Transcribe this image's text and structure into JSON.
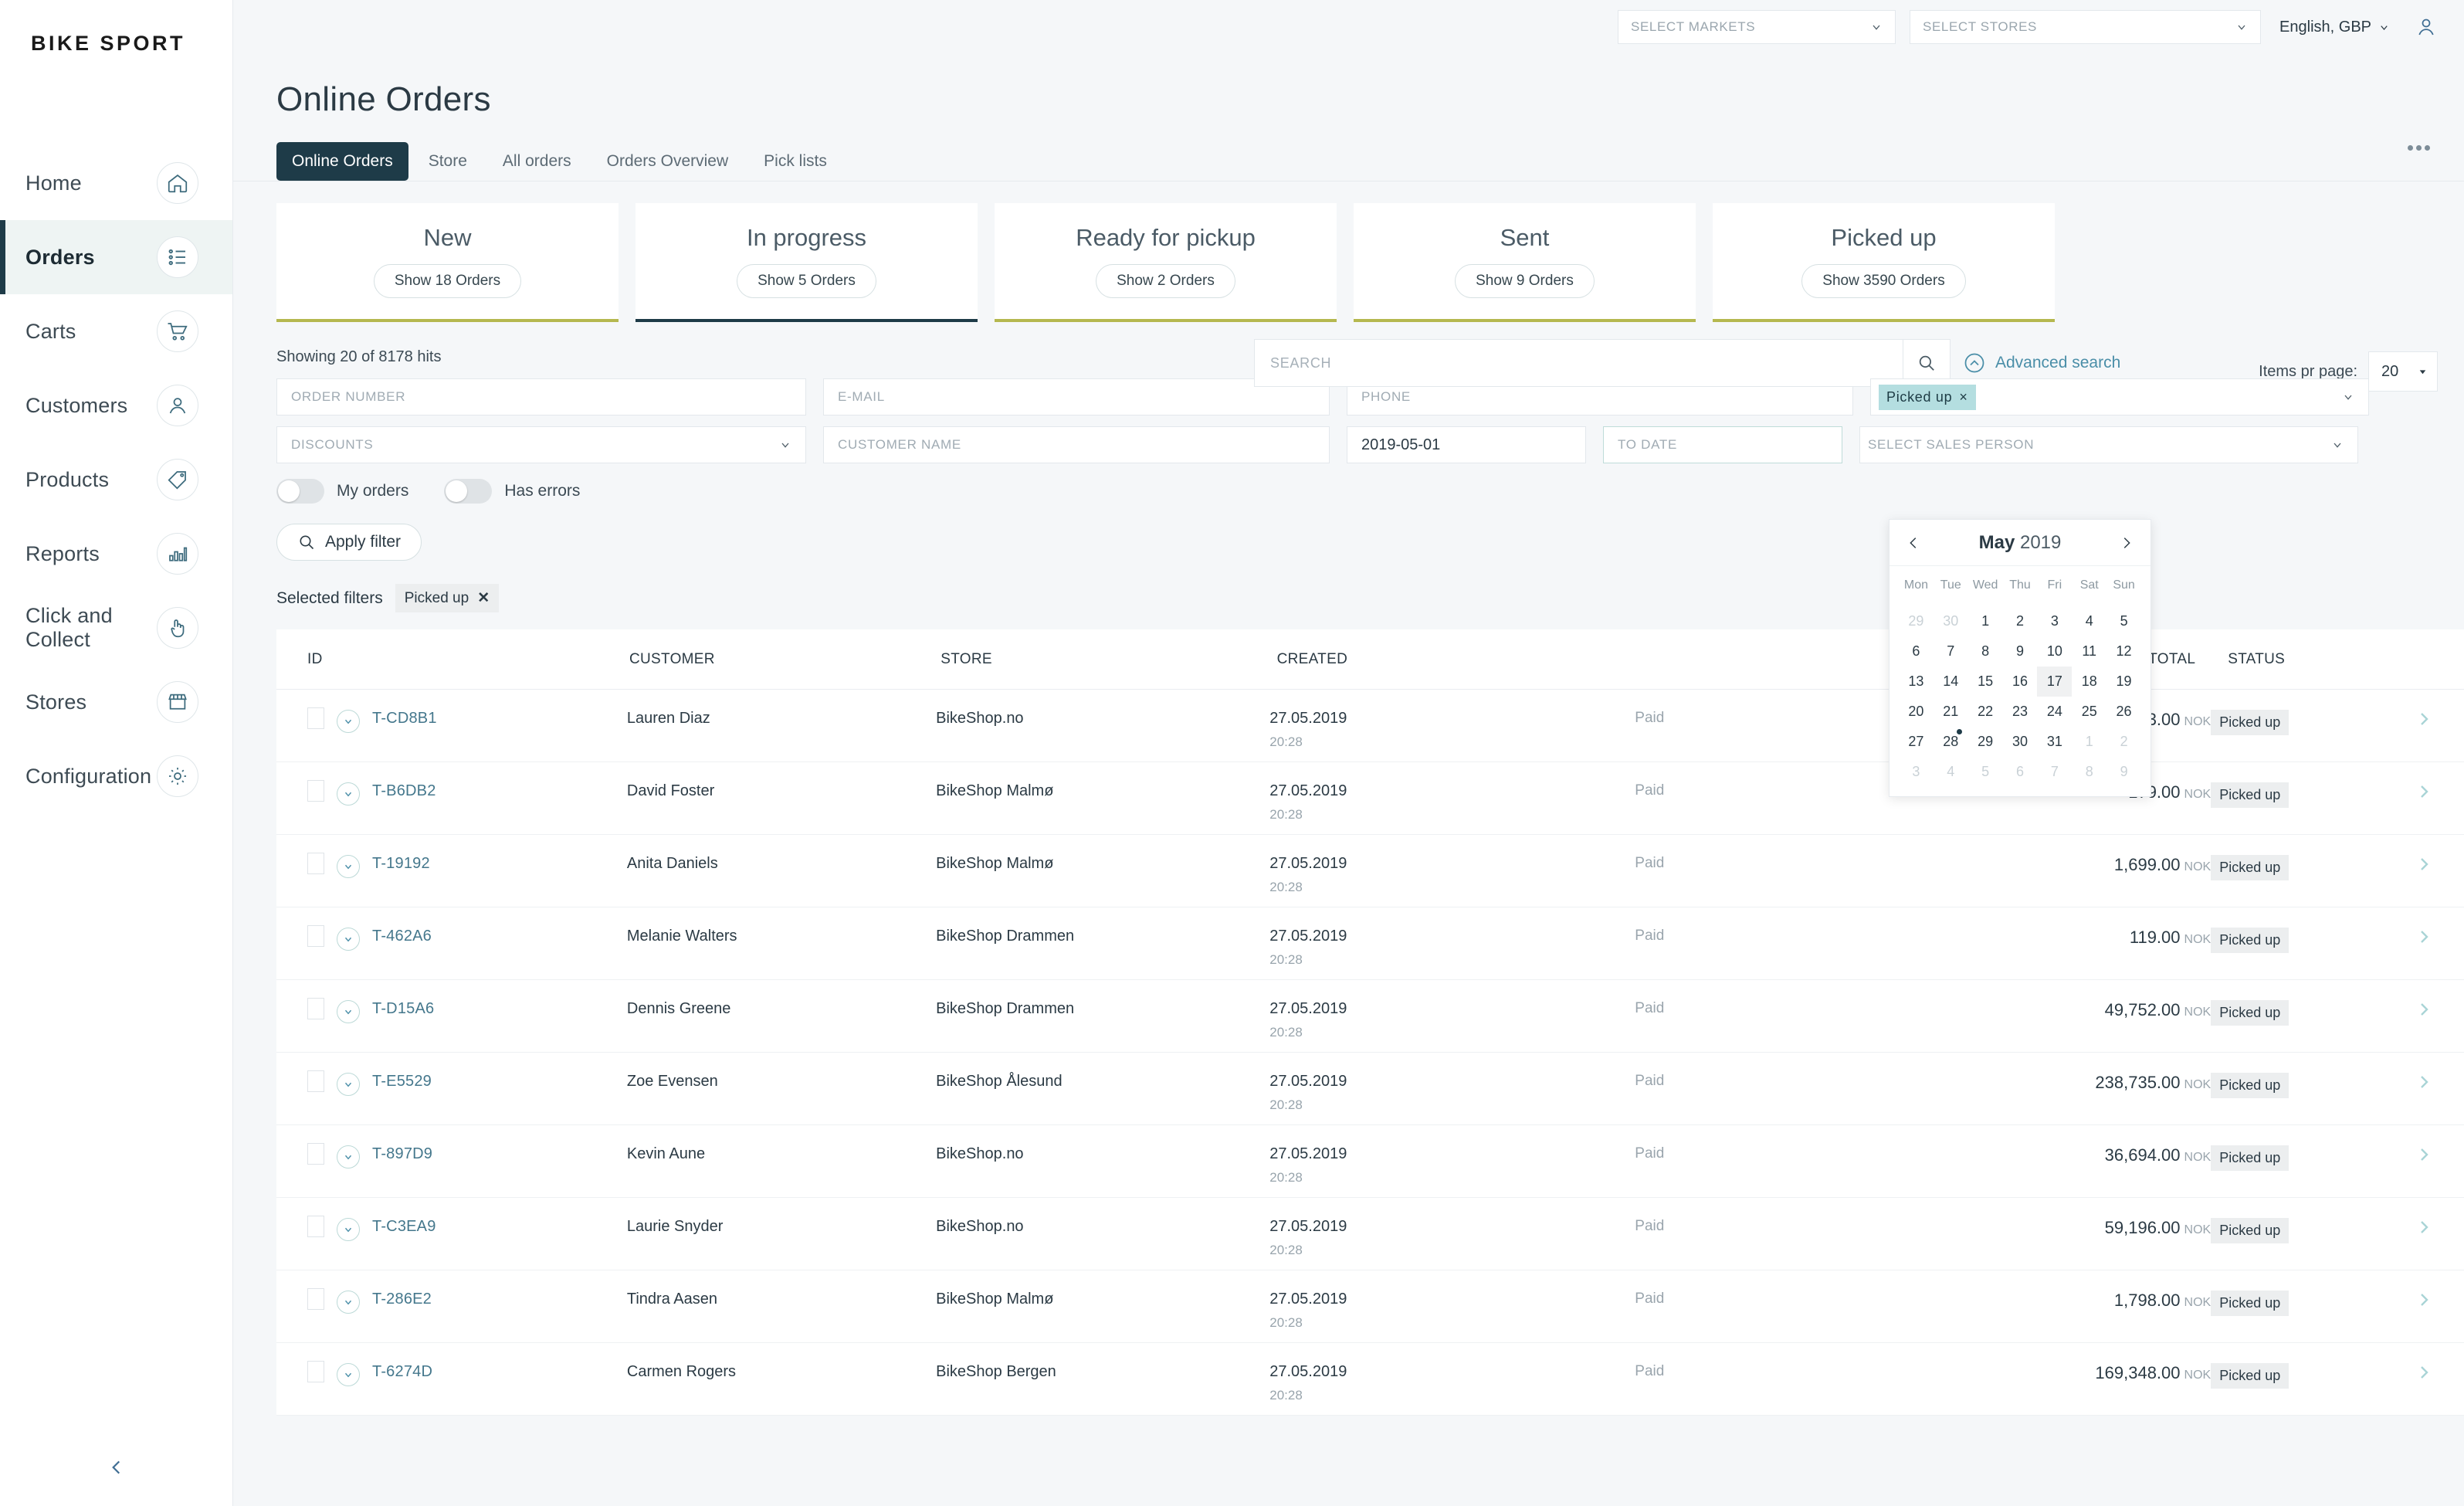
{
  "brand": {
    "name": "BIKE SPORT"
  },
  "sidebar": {
    "items": [
      {
        "label": "Home",
        "icon": "home-icon"
      },
      {
        "label": "Orders",
        "icon": "orders-list-icon"
      },
      {
        "label": "Carts",
        "icon": "cart-icon"
      },
      {
        "label": "Customers",
        "icon": "customer-icon"
      },
      {
        "label": "Products",
        "icon": "tag-icon"
      },
      {
        "label": "Reports",
        "icon": "bar-chart-icon"
      },
      {
        "label": "Click and Collect",
        "icon": "hand-pointer-icon"
      },
      {
        "label": "Stores",
        "icon": "storefront-icon"
      },
      {
        "label": "Configuration",
        "icon": "gear-icon"
      }
    ],
    "active_index": 1,
    "collapse_icon": "chevron-left-icon"
  },
  "topbar": {
    "markets_placeholder": "SELECT MARKETS",
    "stores_placeholder": "SELECT STORES",
    "language": "English, GBP",
    "avatar_icon": "user-avatar-icon"
  },
  "header": {
    "title": "Online Orders",
    "tabs": [
      {
        "label": "Online Orders",
        "active": true
      },
      {
        "label": "Store",
        "active": false
      },
      {
        "label": "All orders",
        "active": false
      },
      {
        "label": "Orders Overview",
        "active": false
      },
      {
        "label": "Pick lists",
        "active": false
      }
    ],
    "overflow_icon": "more-horizontal-icon"
  },
  "status_cards": [
    {
      "title": "New",
      "button": "Show 18 Orders",
      "accent": "#b5b84f"
    },
    {
      "title": "In progress",
      "button": "Show 5 Orders",
      "accent": "#1e3b48"
    },
    {
      "title": "Ready for pickup",
      "button": "Show 2 Orders",
      "accent": "#b5b84f"
    },
    {
      "title": "Sent",
      "button": "Show 9 Orders",
      "accent": "#b5b84f"
    },
    {
      "title": "Picked up",
      "button": "Show 3590 Orders",
      "accent": "#b5b84f"
    }
  ],
  "search": {
    "hits": "Showing 20 of 8178 hits",
    "placeholder": "SEARCH",
    "value": "",
    "search_icon": "magnifier-icon",
    "advanced_label": "Advanced search",
    "advanced_icon": "chevron-up-circle-icon",
    "items_per_page_label": "Items pr page:",
    "items_per_page_value": "20"
  },
  "filters": {
    "order_number_placeholder": "ORDER NUMBER",
    "order_number_value": "",
    "email_placeholder": "E-MAIL",
    "email_value": "",
    "phone_placeholder": "PHONE",
    "phone_value": "",
    "status_chip": "Picked up",
    "status_chip_remove": "×",
    "discounts_placeholder": "DISCOUNTS",
    "customer_name_placeholder": "CUSTOMER NAME",
    "from_date_value": "2019-05-01",
    "to_date_placeholder": "TO DATE",
    "to_date_value": "",
    "sales_person_placeholder": "SELECT SALES PERSON",
    "toggle_my_orders": "My orders",
    "toggle_has_errors": "Has errors",
    "apply_label": "Apply filter",
    "apply_icon": "magnifier-icon"
  },
  "datepicker": {
    "month": "May",
    "year": "2019",
    "prev_icon": "chevron-left-icon",
    "next_icon": "chevron-right-icon",
    "dow": [
      "Mon",
      "Tue",
      "Wed",
      "Thu",
      "Fri",
      "Sat",
      "Sun"
    ],
    "weeks": [
      [
        {
          "d": "29",
          "out": true
        },
        {
          "d": "30",
          "out": true
        },
        {
          "d": "1"
        },
        {
          "d": "2"
        },
        {
          "d": "3"
        },
        {
          "d": "4"
        },
        {
          "d": "5"
        }
      ],
      [
        {
          "d": "6"
        },
        {
          "d": "7"
        },
        {
          "d": "8"
        },
        {
          "d": "9"
        },
        {
          "d": "10"
        },
        {
          "d": "11"
        },
        {
          "d": "12"
        }
      ],
      [
        {
          "d": "13"
        },
        {
          "d": "14"
        },
        {
          "d": "15"
        },
        {
          "d": "16"
        },
        {
          "d": "17",
          "selected": true
        },
        {
          "d": "18"
        },
        {
          "d": "19"
        }
      ],
      [
        {
          "d": "20"
        },
        {
          "d": "21"
        },
        {
          "d": "22"
        },
        {
          "d": "23"
        },
        {
          "d": "24"
        },
        {
          "d": "25"
        },
        {
          "d": "26"
        }
      ],
      [
        {
          "d": "27"
        },
        {
          "d": "28",
          "dot": true
        },
        {
          "d": "29"
        },
        {
          "d": "30"
        },
        {
          "d": "31"
        },
        {
          "d": "1",
          "out": true
        },
        {
          "d": "2",
          "out": true
        }
      ],
      [
        {
          "d": "3",
          "out": true
        },
        {
          "d": "4",
          "out": true
        },
        {
          "d": "5",
          "out": true
        },
        {
          "d": "6",
          "out": true
        },
        {
          "d": "7",
          "out": true
        },
        {
          "d": "8",
          "out": true
        },
        {
          "d": "9",
          "out": true
        }
      ]
    ]
  },
  "selected_filters": {
    "label": "Selected filters",
    "chips": [
      {
        "label": "Picked up",
        "remove": "✕"
      }
    ]
  },
  "table": {
    "columns": [
      "ID",
      "CUSTOMER",
      "STORE",
      "CREATED",
      "",
      "TOTAL",
      "STATUS"
    ],
    "rows": [
      {
        "id": "T-CD8B1",
        "customer": "Lauren Diaz",
        "store": "BikeShop.no",
        "created_date": "27.05.2019",
        "created_time": "20:28",
        "payment": "Paid",
        "total": "216,393.00",
        "currency": "NOK",
        "status": "Picked up"
      },
      {
        "id": "T-B6DB2",
        "customer": "David Foster",
        "store": "BikeShop Malmø",
        "created_date": "27.05.2019",
        "created_time": "20:28",
        "payment": "Paid",
        "total": "179.00",
        "currency": "NOK",
        "status": "Picked up"
      },
      {
        "id": "T-19192",
        "customer": "Anita Daniels",
        "store": "BikeShop Malmø",
        "created_date": "27.05.2019",
        "created_time": "20:28",
        "payment": "Paid",
        "total": "1,699.00",
        "currency": "NOK",
        "status": "Picked up"
      },
      {
        "id": "T-462A6",
        "customer": "Melanie Walters",
        "store": "BikeShop Drammen",
        "created_date": "27.05.2019",
        "created_time": "20:28",
        "payment": "Paid",
        "total": "119.00",
        "currency": "NOK",
        "status": "Picked up"
      },
      {
        "id": "T-D15A6",
        "customer": "Dennis Greene",
        "store": "BikeShop Drammen",
        "created_date": "27.05.2019",
        "created_time": "20:28",
        "payment": "Paid",
        "total": "49,752.00",
        "currency": "NOK",
        "status": "Picked up"
      },
      {
        "id": "T-E5529",
        "customer": "Zoe Evensen",
        "store": "BikeShop Ålesund",
        "created_date": "27.05.2019",
        "created_time": "20:28",
        "payment": "Paid",
        "total": "238,735.00",
        "currency": "NOK",
        "status": "Picked up"
      },
      {
        "id": "T-897D9",
        "customer": "Kevin Aune",
        "store": "BikeShop.no",
        "created_date": "27.05.2019",
        "created_time": "20:28",
        "payment": "Paid",
        "total": "36,694.00",
        "currency": "NOK",
        "status": "Picked up"
      },
      {
        "id": "T-C3EA9",
        "customer": "Laurie Snyder",
        "store": "BikeShop.no",
        "created_date": "27.05.2019",
        "created_time": "20:28",
        "payment": "Paid",
        "total": "59,196.00",
        "currency": "NOK",
        "status": "Picked up"
      },
      {
        "id": "T-286E2",
        "customer": "Tindra Aasen",
        "store": "BikeShop Malmø",
        "created_date": "27.05.2019",
        "created_time": "20:28",
        "payment": "Paid",
        "total": "1,798.00",
        "currency": "NOK",
        "status": "Picked up"
      },
      {
        "id": "T-6274D",
        "customer": "Carmen Rogers",
        "store": "BikeShop Bergen",
        "created_date": "27.05.2019",
        "created_time": "20:28",
        "payment": "Paid",
        "total": "169,348.00",
        "currency": "NOK",
        "status": "Picked up"
      }
    ]
  },
  "colors": {
    "accent_dark": "#1e3b48",
    "accent_link": "#44778c",
    "chip_blue": "#b4dee0",
    "card_accent": "#b5b84f",
    "page_bg": "#f5f7f9"
  }
}
